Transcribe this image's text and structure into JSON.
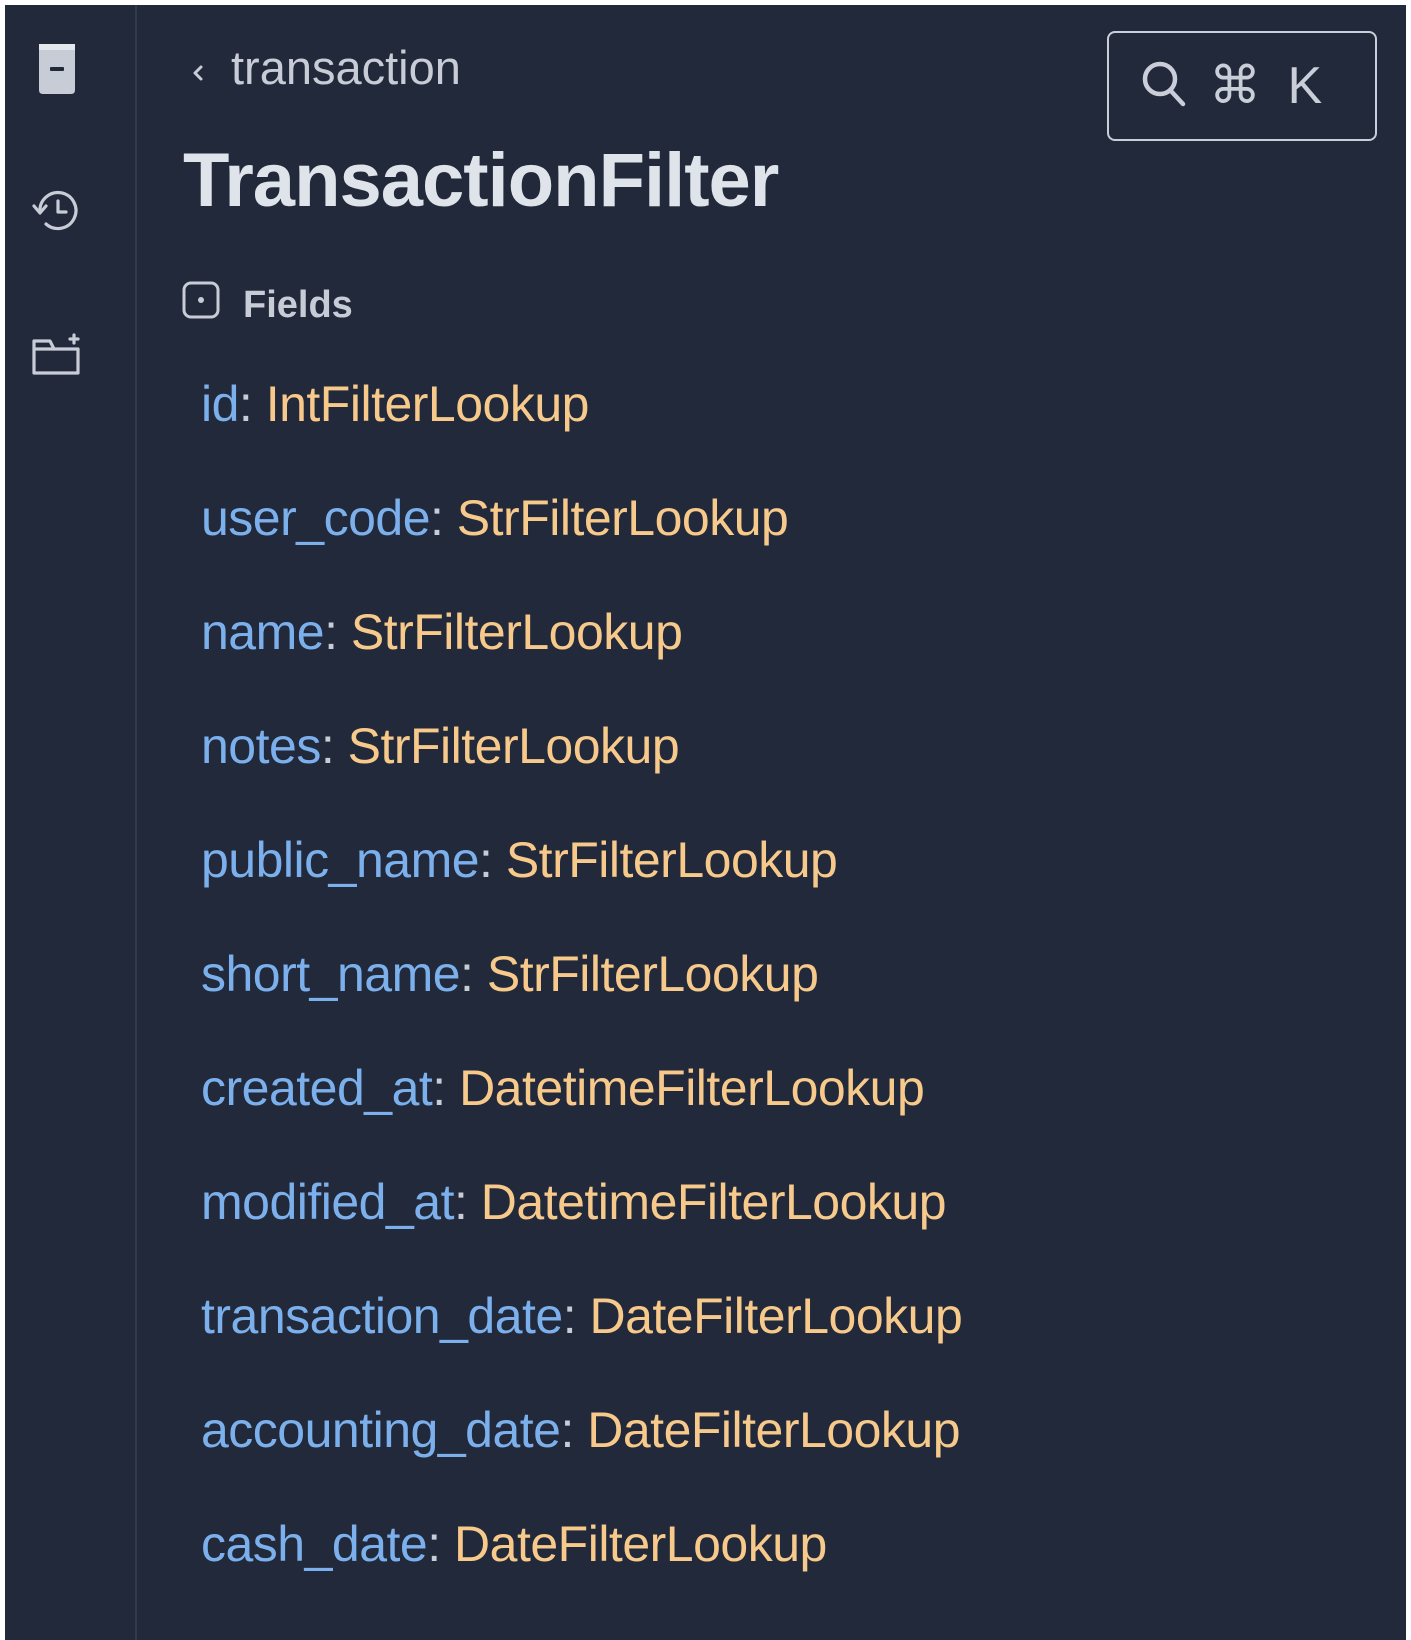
{
  "rail": {
    "icons": [
      "book-icon",
      "history-icon",
      "folder-plus-icon"
    ]
  },
  "header": {
    "breadcrumb": "transaction",
    "title": "TransactionFilter",
    "search_shortcut": "⌘ K"
  },
  "section": {
    "label": "Fields"
  },
  "fields": [
    {
      "name": "id",
      "sep": ": ",
      "type": "IntFilterLookup"
    },
    {
      "name": "user_code",
      "sep": ": ",
      "type": "StrFilterLookup"
    },
    {
      "name": "name",
      "sep": ": ",
      "type": "StrFilterLookup"
    },
    {
      "name": "notes",
      "sep": ": ",
      "type": "StrFilterLookup"
    },
    {
      "name": "public_name",
      "sep": ": ",
      "type": "StrFilterLookup"
    },
    {
      "name": "short_name",
      "sep": ": ",
      "type": "StrFilterLookup"
    },
    {
      "name": "created_at",
      "sep": ": ",
      "type": "DatetimeFilterLookup"
    },
    {
      "name": "modified_at",
      "sep": ": ",
      "type": "DatetimeFilterLookup"
    },
    {
      "name": "transaction_date",
      "sep": ": ",
      "type": "DateFilterLookup"
    },
    {
      "name": "accounting_date",
      "sep": ": ",
      "type": "DateFilterLookup"
    },
    {
      "name": "cash_date",
      "sep": ": ",
      "type": "DateFilterLookup"
    }
  ],
  "colors": {
    "background": "#21293a",
    "field_name": "#7cb0ec",
    "field_type": "#f7c98b",
    "text": "#c7ccd6"
  }
}
